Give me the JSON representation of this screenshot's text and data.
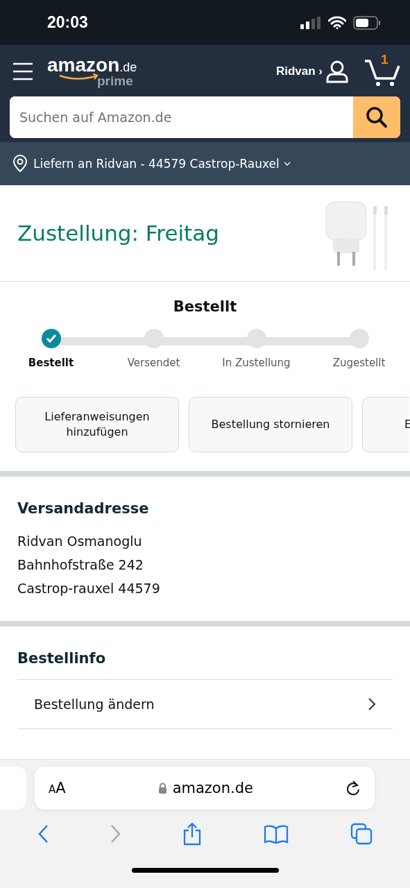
{
  "status_bar": {
    "time": "20:03"
  },
  "header": {
    "logo": "amazon",
    "logo_suffix": ".de",
    "logo_sub": "prime",
    "account": "Ridvan ›",
    "cart_count": "1"
  },
  "search": {
    "placeholder": "Suchen auf Amazon.de"
  },
  "location": {
    "text": "Liefern an Ridvan - 44579 Castrop-Rauxel"
  },
  "delivery": {
    "title": "Zustellung: Freitag"
  },
  "tracker": {
    "title": "Bestellt",
    "steps": [
      {
        "label": "Bestellt",
        "completed": true
      },
      {
        "label": "Versendet",
        "completed": false
      },
      {
        "label": "In Zustellung",
        "completed": false
      },
      {
        "label": "Zugestellt",
        "completed": false
      }
    ]
  },
  "actions": [
    "Lieferanweisungen hinzufügen",
    "Bestellung stornieren",
    "E"
  ],
  "address": {
    "title": "Versandadresse",
    "lines": [
      "Ridvan Osmanoglu",
      "Bahnhofstraße 242",
      "Castrop-rauxel 44579"
    ]
  },
  "order_info": {
    "title": "Bestellinfo",
    "rows": [
      "Bestellung ändern"
    ]
  },
  "browser": {
    "text_size": "AA",
    "url": "amazon.de",
    "back_disabled": false,
    "forward_disabled": true
  }
}
